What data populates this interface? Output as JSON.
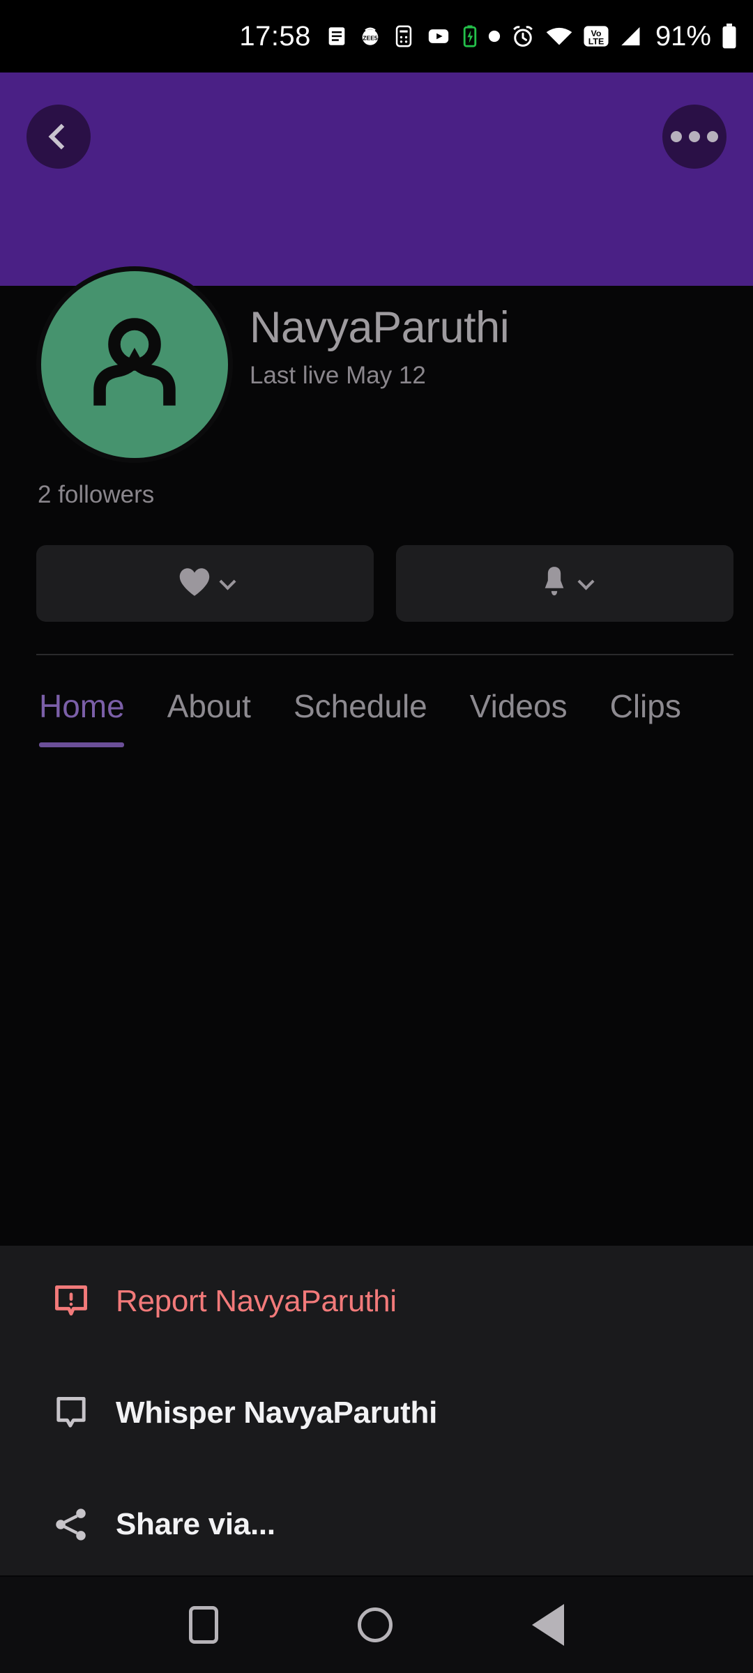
{
  "status_bar": {
    "time": "17:58",
    "battery_percent": "91%",
    "icons": [
      "notes-icon",
      "zee5-icon",
      "calculator-icon",
      "youtube-icon",
      "battery-charging-icon",
      "dot-icon",
      "alarm-icon",
      "wifi-icon",
      "volte-icon",
      "signal-icon",
      "battery-icon"
    ]
  },
  "header": {
    "back_icon": "chevron-left-icon",
    "more_icon": "more-horizontal-icon",
    "banner_color": "#4A2085"
  },
  "profile": {
    "avatar_icon": "person-icon",
    "avatar_color": "#46936E",
    "username": "NavyaParuthi",
    "last_live": "Last live May 12",
    "followers": "2 followers"
  },
  "actions": [
    {
      "name": "follow-button",
      "icon": "heart-icon",
      "chevron": "chevron-down-icon"
    },
    {
      "name": "notifications-button",
      "icon": "bell-icon",
      "chevron": "chevron-down-icon"
    }
  ],
  "tabs": [
    {
      "label": "Home",
      "active": true
    },
    {
      "label": "About",
      "active": false
    },
    {
      "label": "Schedule",
      "active": false
    },
    {
      "label": "Videos",
      "active": false
    },
    {
      "label": "Clips",
      "active": false
    }
  ],
  "tab_active_color": "#7B5FA8",
  "sheet": {
    "items": [
      {
        "label": "Report NavyaParuthi",
        "icon": "report-icon",
        "color": "#F27A7A"
      },
      {
        "label": "Whisper NavyaParuthi",
        "icon": "whisper-icon",
        "color": "#F2F2F4"
      },
      {
        "label": "Share via...",
        "icon": "share-icon",
        "color": "#F2F2F4"
      }
    ]
  },
  "nav_bar": {
    "recents": "square-icon",
    "home": "circle-icon",
    "back": "triangle-back-icon"
  }
}
